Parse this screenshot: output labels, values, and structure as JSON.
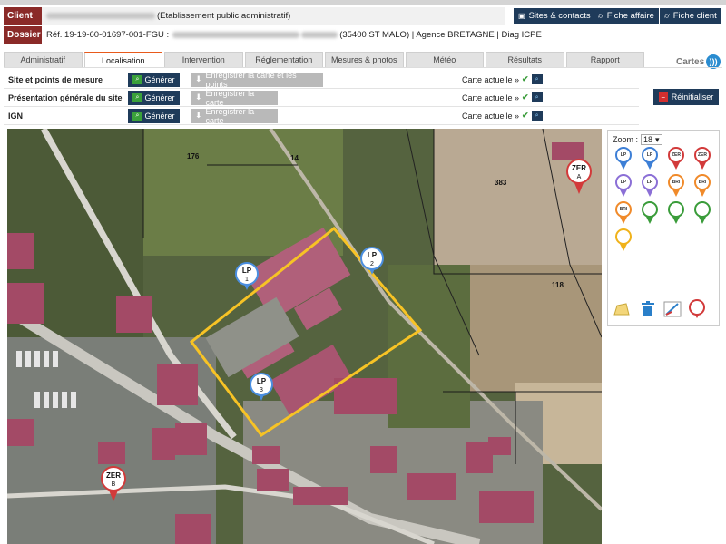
{
  "header": {
    "client_label": "Client",
    "client_suffix": "(Etablissement public administratif)",
    "dossier_label": "Dossier",
    "dossier_ref": "Réf. 19-19-60-01697-001-FGU :",
    "dossier_suffix": "(35400 ST MALO) | Agence BRETAGNE | Diag ICPE",
    "buttons": {
      "sites_contacts": "Sites & contacts",
      "fiche_affaire": "Fiche affaire",
      "fiche_client": "Fiche client"
    }
  },
  "tabs": [
    "Administratif",
    "Localisation",
    "Intervention",
    "Réglementation",
    "Mesures & photos",
    "Météo",
    "Résultats",
    "Rapport"
  ],
  "active_tab": "Localisation",
  "cartes_label": "Cartes",
  "rows": [
    {
      "label": "Site et points de mesure",
      "generate": "Générer",
      "save": "Enregistrer la carte et les points",
      "current": "Carte actuelle »"
    },
    {
      "label": "Présentation générale du site",
      "generate": "Générer",
      "save": "Enregistrer la carte",
      "current": "Carte actuelle »"
    },
    {
      "label": "IGN",
      "generate": "Générer",
      "save": "Enregistrer la carte",
      "current": "Carte actuelle »"
    }
  ],
  "reset_label": "Réinitialiser",
  "zoom": {
    "label": "Zoom :",
    "value": "18"
  },
  "map": {
    "parcels": [
      "176",
      "14",
      "383",
      "118"
    ],
    "markers": [
      {
        "code": "LP",
        "num": "1"
      },
      {
        "code": "LP",
        "num": "2"
      },
      {
        "code": "LP",
        "num": "3"
      },
      {
        "code": "ZER",
        "num": "A"
      },
      {
        "code": "ZER",
        "num": "B"
      }
    ]
  },
  "palette": [
    {
      "code": "LP",
      "color": "#3d7fd6"
    },
    {
      "code": "LP",
      "color": "#3d7fd6"
    },
    {
      "code": "ZER",
      "color": "#d23a3a"
    },
    {
      "code": "ZER",
      "color": "#d23a3a"
    },
    {
      "code": "LP",
      "color": "#8b6fd6"
    },
    {
      "code": "LP",
      "color": "#8b6fd6"
    },
    {
      "code": "BRI",
      "color": "#f08a2a"
    },
    {
      "code": "BRI",
      "color": "#f08a2a"
    },
    {
      "code": "BRI",
      "color": "#f08a2a"
    },
    {
      "code": "",
      "color": "#3a9c3a"
    },
    {
      "code": "",
      "color": "#3a9c3a"
    },
    {
      "code": "",
      "color": "#3a9c3a"
    },
    {
      "code": "",
      "color": "#f0b21a"
    }
  ],
  "colors": {
    "brand": "#1f3b5a",
    "label_bg": "#8a2a28",
    "accent": "#e85a1c",
    "site_outline": "#f7c325",
    "roof": "#b0607a"
  }
}
